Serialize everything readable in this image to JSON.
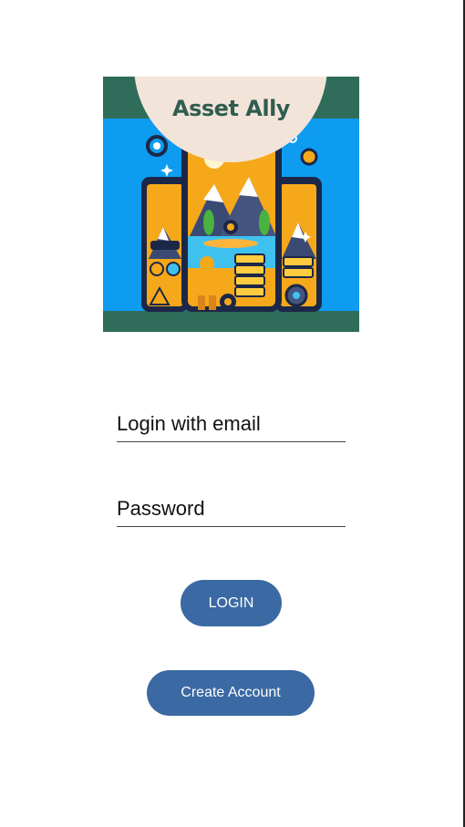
{
  "logo": {
    "title": "Asset Ally",
    "colors": {
      "background": "#0d9cf0",
      "band": "#2f6d5a",
      "badge": "#f3e4da",
      "title": "#2f5d50",
      "accent": "#f6a81b"
    }
  },
  "form": {
    "email_placeholder": "Login with email",
    "password_placeholder": "Password"
  },
  "buttons": {
    "login_label": "LOGIN",
    "create_account_label": "Create Account",
    "color": "#3a69a3"
  }
}
